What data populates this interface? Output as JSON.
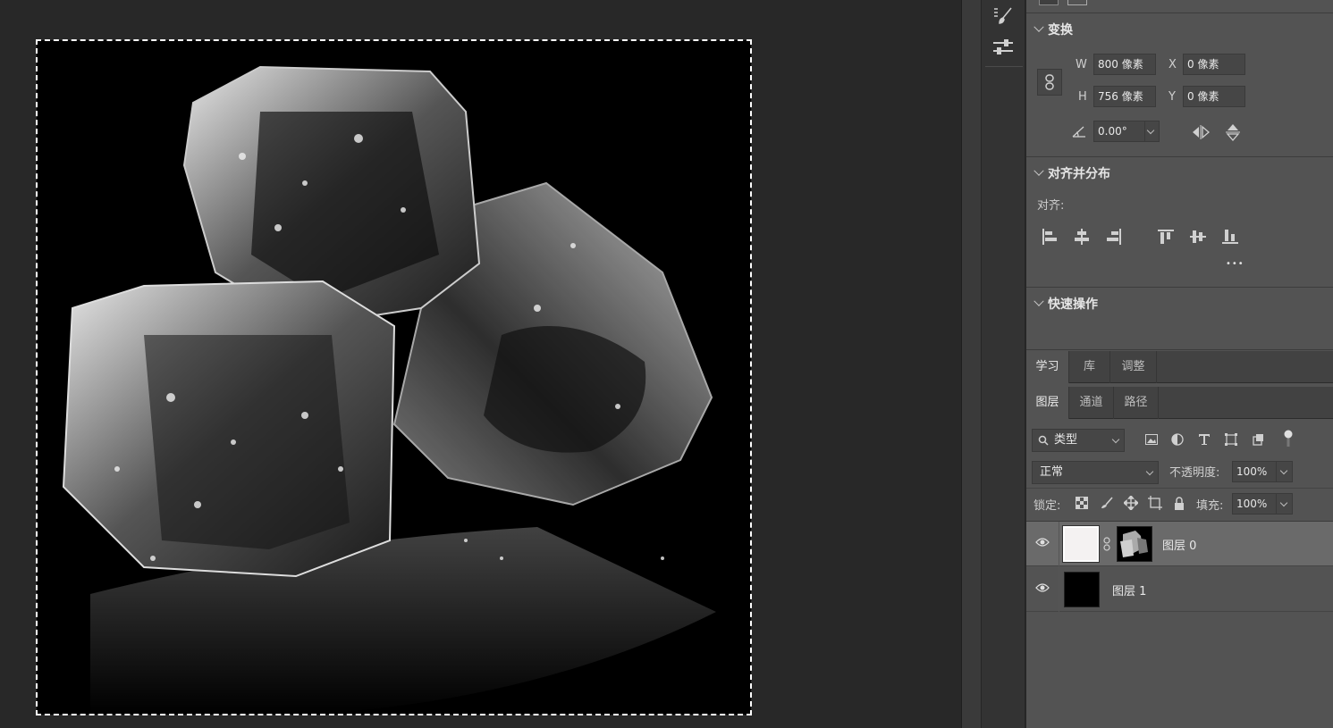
{
  "transform": {
    "title": "变换",
    "w_label": "W",
    "w_value": "800 像素",
    "h_label": "H",
    "h_value": "756 像素",
    "x_label": "X",
    "x_value": "0 像素",
    "y_label": "Y",
    "y_value": "0 像素",
    "angle_value": "0.00°"
  },
  "align": {
    "title": "对齐并分布",
    "align_label": "对齐:",
    "more": "•••"
  },
  "quick_actions": {
    "title": "快速操作"
  },
  "top_tabs": [
    "学习",
    "库",
    "调整"
  ],
  "layer_tabs": [
    "图层",
    "通道",
    "路径"
  ],
  "layer_filter": {
    "kind_label": "类型"
  },
  "blend": {
    "mode": "正常",
    "opacity_label": "不透明度:",
    "opacity_value": "100%"
  },
  "lock": {
    "lock_label": "锁定:",
    "fill_label": "填充:",
    "fill_value": "100%"
  },
  "layers": [
    {
      "name": "图层 0",
      "selected": true
    },
    {
      "name": "图层 1",
      "selected": false
    }
  ],
  "colors": {
    "panel": "#535353",
    "canvas_bg": "#282828",
    "selected_row": "#6a6a6a"
  }
}
